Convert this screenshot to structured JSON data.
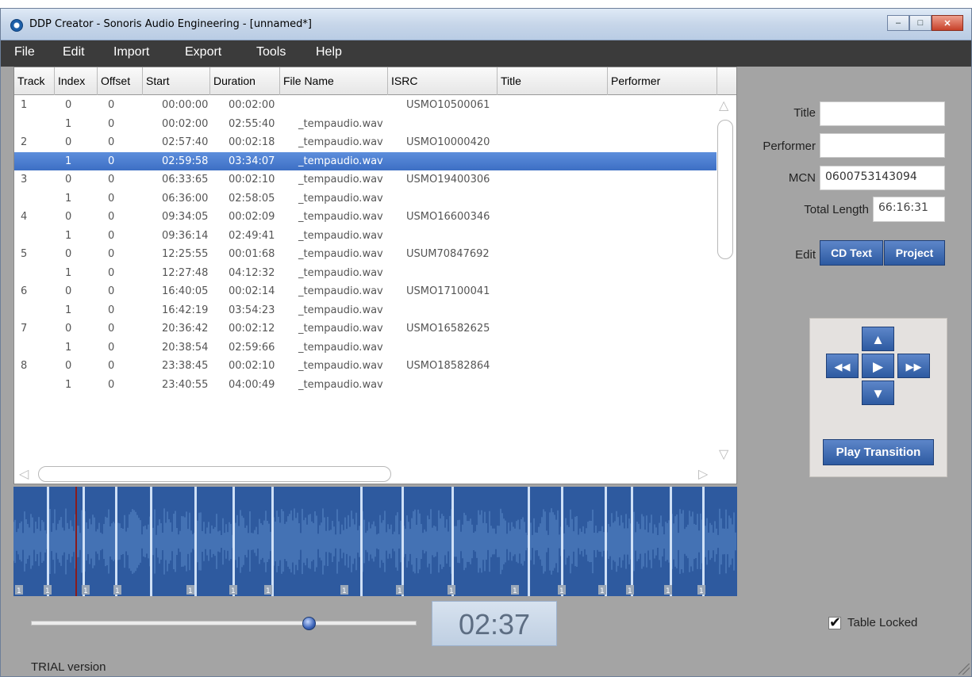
{
  "window": {
    "title": "DDP Creator - Sonoris Audio Engineering - [unnamed*]",
    "buttons": {
      "minimize": "–",
      "maximize": "□",
      "close": "✕"
    }
  },
  "menu": [
    "File",
    "Edit",
    "Import",
    "Export",
    "Tools",
    "Help"
  ],
  "table": {
    "headers": [
      "Track",
      "Index",
      "Offset",
      "Start",
      "Duration",
      "File Name",
      "ISRC",
      "Title",
      "Performer"
    ],
    "rows": [
      {
        "track": "1",
        "index": "0",
        "offset": "0",
        "start": "00:00:00",
        "duration": "00:02:00",
        "file": "",
        "isrc": "USMO10500061"
      },
      {
        "track": "",
        "index": "1",
        "offset": "0",
        "start": "00:02:00",
        "duration": "02:55:40",
        "file": "_tempaudio.wav",
        "isrc": ""
      },
      {
        "track": "2",
        "index": "0",
        "offset": "0",
        "start": "02:57:40",
        "duration": "00:02:18",
        "file": "_tempaudio.wav",
        "isrc": "USMO10000420"
      },
      {
        "track": "",
        "index": "1",
        "offset": "0",
        "start": "02:59:58",
        "duration": "03:34:07",
        "file": "_tempaudio.wav",
        "isrc": "",
        "selected": true
      },
      {
        "track": "3",
        "index": "0",
        "offset": "0",
        "start": "06:33:65",
        "duration": "00:02:10",
        "file": "_tempaudio.wav",
        "isrc": "USMO19400306"
      },
      {
        "track": "",
        "index": "1",
        "offset": "0",
        "start": "06:36:00",
        "duration": "02:58:05",
        "file": "_tempaudio.wav",
        "isrc": ""
      },
      {
        "track": "4",
        "index": "0",
        "offset": "0",
        "start": "09:34:05",
        "duration": "00:02:09",
        "file": "_tempaudio.wav",
        "isrc": "USMO16600346"
      },
      {
        "track": "",
        "index": "1",
        "offset": "0",
        "start": "09:36:14",
        "duration": "02:49:41",
        "file": "_tempaudio.wav",
        "isrc": ""
      },
      {
        "track": "5",
        "index": "0",
        "offset": "0",
        "start": "12:25:55",
        "duration": "00:01:68",
        "file": "_tempaudio.wav",
        "isrc": "USUM70847692"
      },
      {
        "track": "",
        "index": "1",
        "offset": "0",
        "start": "12:27:48",
        "duration": "04:12:32",
        "file": "_tempaudio.wav",
        "isrc": ""
      },
      {
        "track": "6",
        "index": "0",
        "offset": "0",
        "start": "16:40:05",
        "duration": "00:02:14",
        "file": "_tempaudio.wav",
        "isrc": "USMO17100041"
      },
      {
        "track": "",
        "index": "1",
        "offset": "0",
        "start": "16:42:19",
        "duration": "03:54:23",
        "file": "_tempaudio.wav",
        "isrc": ""
      },
      {
        "track": "7",
        "index": "0",
        "offset": "0",
        "start": "20:36:42",
        "duration": "00:02:12",
        "file": "_tempaudio.wav",
        "isrc": "USMO16582625"
      },
      {
        "track": "",
        "index": "1",
        "offset": "0",
        "start": "20:38:54",
        "duration": "02:59:66",
        "file": "_tempaudio.wav",
        "isrc": ""
      },
      {
        "track": "8",
        "index": "0",
        "offset": "0",
        "start": "23:38:45",
        "duration": "00:02:10",
        "file": "_tempaudio.wav",
        "isrc": "USMO18582864"
      },
      {
        "track": "",
        "index": "1",
        "offset": "0",
        "start": "23:40:55",
        "duration": "04:00:49",
        "file": "_tempaudio.wav",
        "isrc": ""
      }
    ]
  },
  "panel": {
    "title_label": "Title",
    "title_value": "",
    "performer_label": "Performer",
    "performer_value": "",
    "mcn_label": "MCN",
    "mcn_value": "0600753143094",
    "total_length_label": "Total Length",
    "total_length_value": "66:16:31",
    "edit_label": "Edit",
    "cd_text_button": "CD Text",
    "project_button": "Project",
    "play_transition_button": "Play Transition"
  },
  "transport": {
    "up": "▲",
    "down": "▼",
    "rewind": "◀◀",
    "play": "▶",
    "forward": "▶▶"
  },
  "playback": {
    "time": "02:37",
    "position_fraction": 0.72
  },
  "footer": {
    "trial_text": "TRIAL version",
    "table_locked_label": "Table Locked"
  },
  "waveform": {
    "track_markers": [
      "1",
      "1",
      "1",
      "1",
      "1",
      "1",
      "1",
      "1",
      "1",
      "1",
      "1",
      "1",
      "1",
      "1",
      "1",
      "1",
      "1",
      "1",
      "1"
    ]
  },
  "colors": {
    "selection": "#3d6fc4",
    "waveform_bg": "#2e5a9f",
    "waveform_fg": "#7fb0ea",
    "button_blue": "#2d5aa1",
    "menubar": "#3b3b3b"
  }
}
